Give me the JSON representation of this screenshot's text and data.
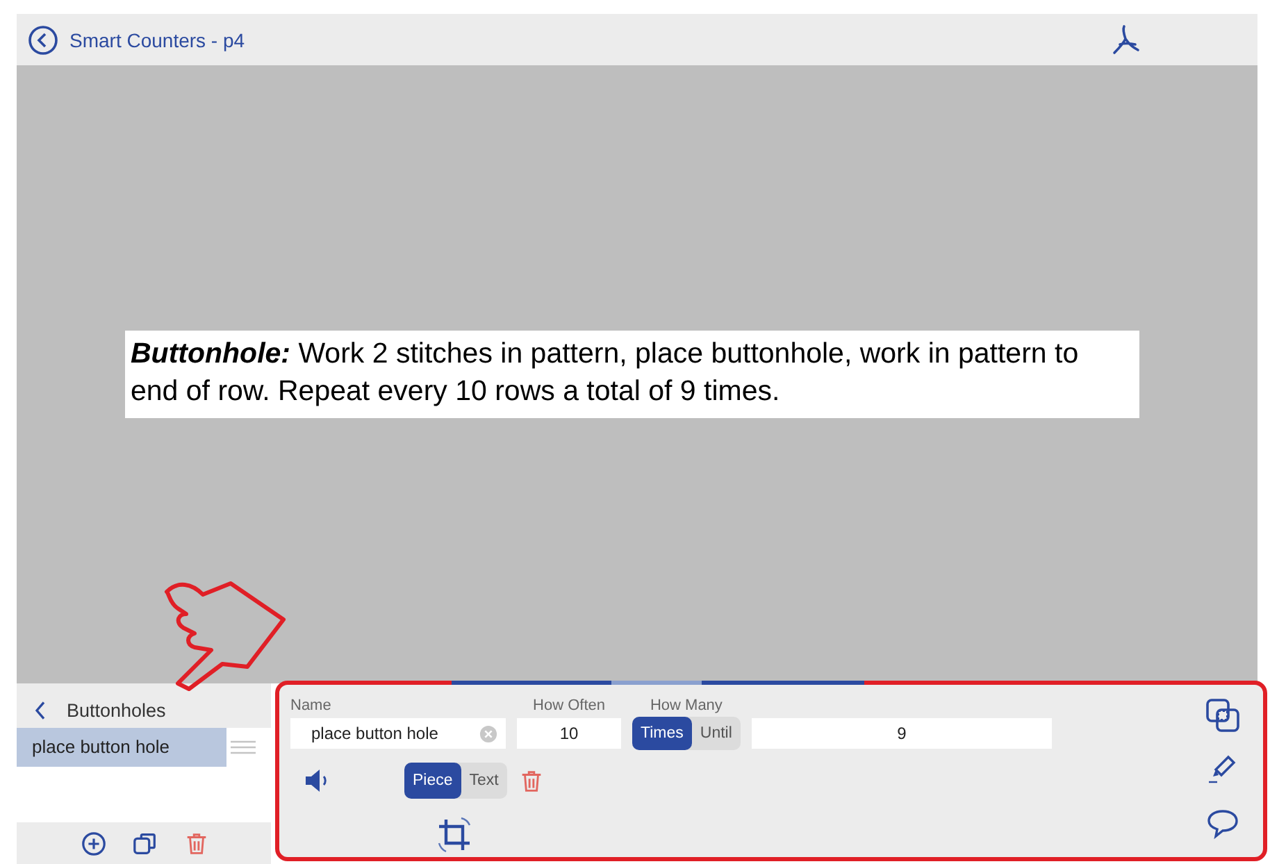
{
  "header": {
    "title": "Smart Counters - p4"
  },
  "document": {
    "text": "**Buttonhole:** Work 2 stitches in pattern, place buttonhole, work in pattern to end of row. Repeat every 10 rows a total of 9 times."
  },
  "sidebar": {
    "title": "Buttonholes",
    "items": [
      {
        "label": "place button hole",
        "selected": true
      }
    ]
  },
  "editor": {
    "name": {
      "label": "Name",
      "value": "place button hole"
    },
    "how_often": {
      "label": "How Often",
      "value": "10"
    },
    "how_many": {
      "label": "How Many",
      "modes": [
        {
          "label": "Times",
          "selected": true
        },
        {
          "label": "Until",
          "selected": false
        }
      ],
      "value": "9"
    },
    "display": [
      {
        "label": "Piece",
        "selected": true
      },
      {
        "label": "Text",
        "selected": false
      }
    ]
  }
}
